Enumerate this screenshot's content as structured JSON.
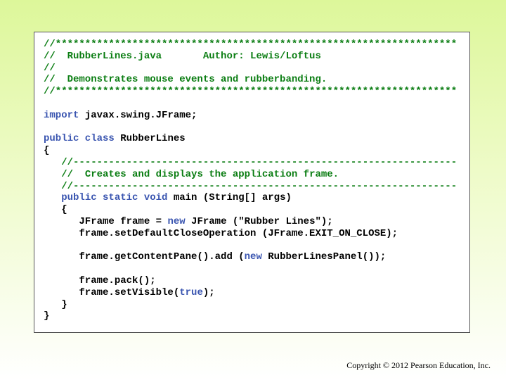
{
  "code_lines": [
    [
      {
        "t": "c",
        "v": "//********************************************************************"
      }
    ],
    [
      {
        "t": "c",
        "v": "//  RubberLines.java       Author: Lewis/Loftus"
      }
    ],
    [
      {
        "t": "c",
        "v": "//"
      }
    ],
    [
      {
        "t": "c",
        "v": "//  Demonstrates mouse events and rubberbanding."
      }
    ],
    [
      {
        "t": "c",
        "v": "//********************************************************************"
      }
    ],
    [],
    [
      {
        "t": "k",
        "v": "import"
      },
      {
        "t": "n",
        "v": " javax.swing.JFrame;"
      }
    ],
    [],
    [
      {
        "t": "k",
        "v": "public class"
      },
      {
        "t": "n",
        "v": " RubberLines"
      }
    ],
    [
      {
        "t": "n",
        "v": "{"
      }
    ],
    [
      {
        "t": "n",
        "v": "   "
      },
      {
        "t": "c",
        "v": "//-----------------------------------------------------------------"
      }
    ],
    [
      {
        "t": "n",
        "v": "   "
      },
      {
        "t": "c",
        "v": "//  Creates and displays the application frame."
      }
    ],
    [
      {
        "t": "n",
        "v": "   "
      },
      {
        "t": "c",
        "v": "//-----------------------------------------------------------------"
      }
    ],
    [
      {
        "t": "n",
        "v": "   "
      },
      {
        "t": "k",
        "v": "public static void"
      },
      {
        "t": "n",
        "v": " main (String[] args)"
      }
    ],
    [
      {
        "t": "n",
        "v": "   {"
      }
    ],
    [
      {
        "t": "n",
        "v": "      JFrame frame = "
      },
      {
        "t": "k",
        "v": "new"
      },
      {
        "t": "n",
        "v": " JFrame (\"Rubber Lines\");"
      }
    ],
    [
      {
        "t": "n",
        "v": "      frame.setDefaultCloseOperation (JFrame.EXIT_ON_CLOSE);"
      }
    ],
    [],
    [
      {
        "t": "n",
        "v": "      frame.getContentPane().add ("
      },
      {
        "t": "k",
        "v": "new"
      },
      {
        "t": "n",
        "v": " RubberLinesPanel());"
      }
    ],
    [],
    [
      {
        "t": "n",
        "v": "      frame.pack();"
      }
    ],
    [
      {
        "t": "n",
        "v": "      frame.setVisible("
      },
      {
        "t": "k",
        "v": "true"
      },
      {
        "t": "n",
        "v": ");"
      }
    ],
    [
      {
        "t": "n",
        "v": "   }"
      }
    ],
    [
      {
        "t": "n",
        "v": "}"
      }
    ]
  ],
  "footer": {
    "copyright": "Copyright © 2012 Pearson Education, Inc."
  }
}
